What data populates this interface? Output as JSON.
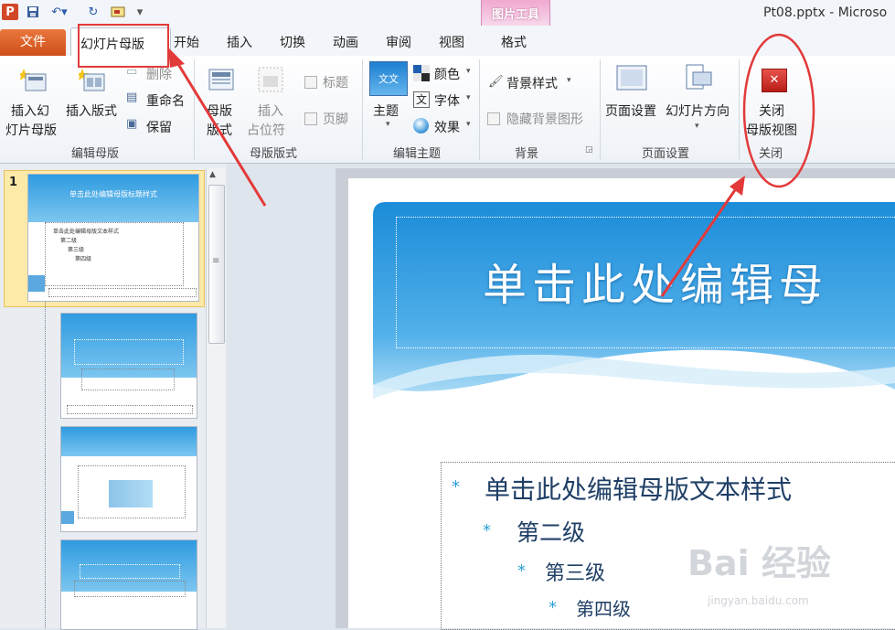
{
  "window": {
    "title": "Pt08.pptx - Microso"
  },
  "context_tab_group": {
    "label": "图片工具",
    "tab": "格式"
  },
  "tabs": {
    "file": "文件",
    "active": "幻灯片母版",
    "items": [
      "开始",
      "插入",
      "切换",
      "动画",
      "审阅",
      "视图"
    ]
  },
  "ribbon": {
    "edit_master": {
      "group": "编辑母版",
      "insert_slide_master_l1": "插入幻",
      "insert_slide_master_l2": "灯片母版",
      "insert_layout": "插入版式",
      "delete": "删除",
      "rename": "重命名",
      "preserve": "保留"
    },
    "master_layout": {
      "group": "母版版式",
      "master_layout_l1": "母版",
      "master_layout_l2": "版式",
      "insert_placeholder_l1": "插入",
      "insert_placeholder_l2": "占位符",
      "title": "标题",
      "footer": "页脚"
    },
    "edit_theme": {
      "group": "编辑主题",
      "themes": "主题",
      "colors": "颜色",
      "fonts": "字体",
      "effects": "效果",
      "theme_sample": "文文"
    },
    "background": {
      "group": "背景",
      "background_styles": "背景样式",
      "hide_background": "隐藏背景图形"
    },
    "page_setup": {
      "group": "页面设置",
      "page_setup": "页面设置",
      "orientation": "幻灯片方向"
    },
    "close": {
      "group": "关闭",
      "close_l1": "关闭",
      "close_l2": "母版视图"
    }
  },
  "thumbnails": {
    "number": "1",
    "master_title": "单击此处编辑母版标题样式",
    "master_body": [
      "单击此处编辑母版文本样式",
      "第二级",
      "第三级",
      "第四级"
    ]
  },
  "slide": {
    "title": "单击此处编辑母",
    "bullets": [
      "单击此处编辑母版文本样式",
      "第二级",
      "第三级",
      "第四级"
    ],
    "bullet_symbol": "*"
  },
  "watermark": {
    "main": "Bai 经验",
    "sub": "jingyan.baidu.com"
  },
  "colors": {
    "accent_red": "#e23a3a",
    "file_tab": "#d65a22",
    "slide_blue": "#2a9ae0",
    "text_navy": "#1f3f66"
  }
}
